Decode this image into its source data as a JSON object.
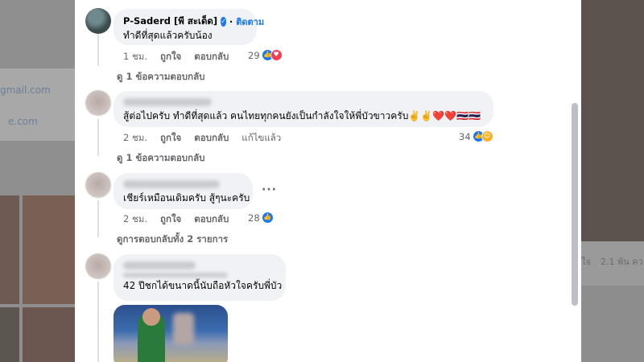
{
  "background": {
    "left_texts": [
      "gmail.com",
      "e.com"
    ],
    "right_texts": [
      "ใจ",
      "2.1 พัน คว"
    ]
  },
  "comments": [
    {
      "author": "P-Saderd [พี สะเด็ด]",
      "verified_symbol": "✓",
      "follow_label": "ติดตาม",
      "text": "ทำดีที่สุดแล้วครับน้อง",
      "time": "1 ชม.",
      "like_label": "ถูกใจ",
      "reply_label": "ตอบกลับ",
      "reaction_count": "29",
      "view_replies": "ดู 1 ข้อความตอบกลับ"
    },
    {
      "text": "สู้ต่อไปครับ ทำดีที่สุดแล้ว คนไทยทุกคนยังเป็นกำลังใจให้พี่บัวขาวครับ✌️✌️❤️❤️🇹🇭🇹🇭",
      "time": "2 ชม.",
      "like_label": "ถูกใจ",
      "reply_label": "ตอบกลับ",
      "edited_label": "แก้ไขแล้ว",
      "reaction_count": "34",
      "view_replies": "ดู 1 ข้อความตอบกลับ"
    },
    {
      "text": "เชียร์เหมือนเดิมครับ สู้ๆนะครับ",
      "time": "2 ชม.",
      "like_label": "ถูกใจ",
      "reply_label": "ตอบกลับ",
      "reaction_count": "28",
      "more_label": "···",
      "view_replies": "ดูการตอบกลับทั้ง 2 รายการ"
    },
    {
      "text": "42 ปีชกได้ขนาดนี้นับถือหัวใจครับพี่บัว"
    }
  ],
  "colors": {
    "accent": "#1877f2",
    "bubble": "#f0f2f5",
    "meta": "#65676b",
    "love": "#f33e58",
    "care": "#f7b125"
  }
}
